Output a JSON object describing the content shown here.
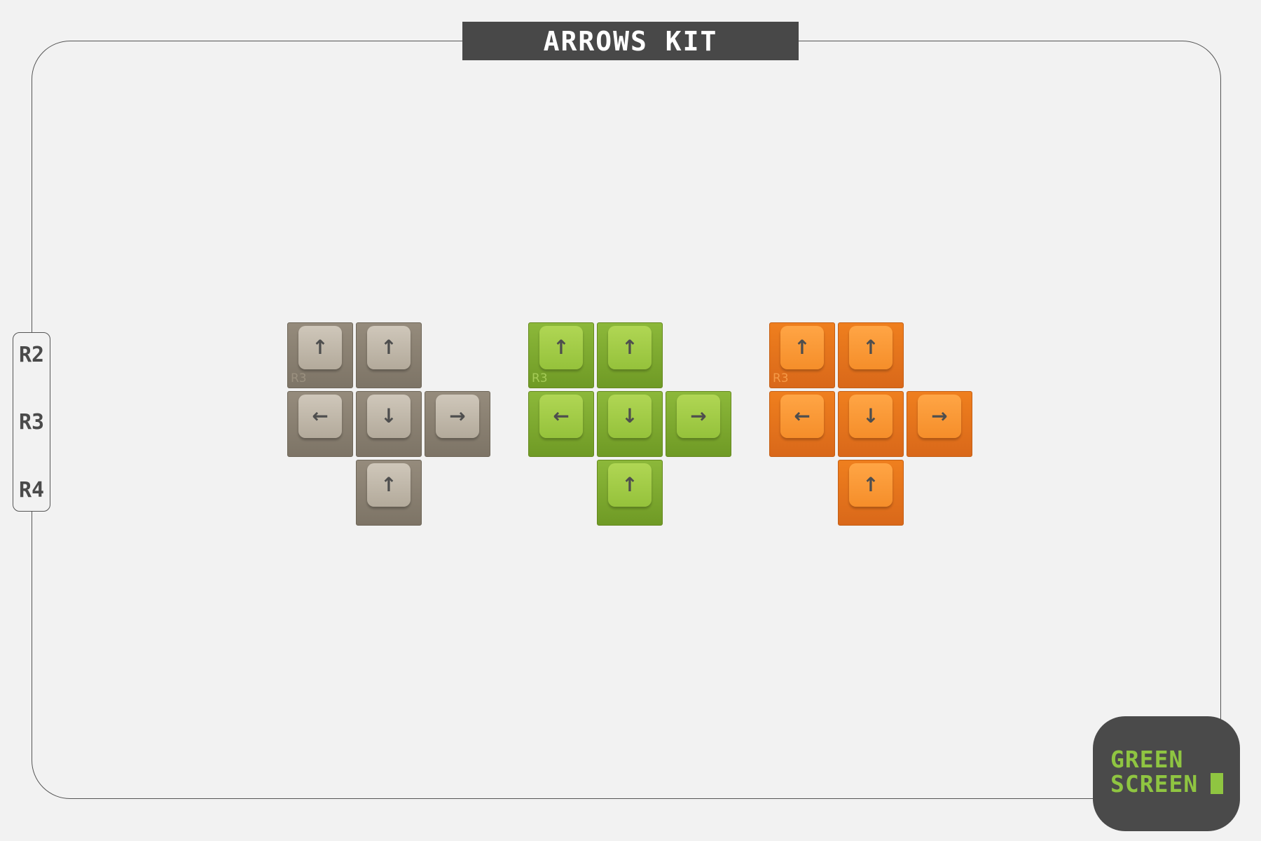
{
  "title": "ARROWS KIT",
  "row_labels": [
    "R2",
    "R3",
    "R4"
  ],
  "row_tag": "R3",
  "colors": {
    "beige": "#b3aa9b",
    "green": "#95c23b",
    "orange": "#f58e2a",
    "legend": "#4e4e4e",
    "logo_bg": "#4a4a4a",
    "logo_text": "#8fc541"
  },
  "kits": [
    {
      "colorway": "beige",
      "keys": [
        {
          "glyph": "↑",
          "icon": "up-arrow-icon",
          "tag": true
        },
        {
          "glyph": "↑",
          "icon": "up-arrow-icon",
          "tag": false
        },
        {
          "glyph": "←",
          "icon": "left-arrow-icon",
          "tag": false
        },
        {
          "glyph": "↓",
          "icon": "down-arrow-icon",
          "tag": false
        },
        {
          "glyph": "→",
          "icon": "right-arrow-icon",
          "tag": false
        },
        {
          "glyph": "↑",
          "icon": "up-arrow-icon",
          "tag": false
        }
      ]
    },
    {
      "colorway": "green",
      "keys": [
        {
          "glyph": "↑",
          "icon": "up-arrow-icon",
          "tag": true
        },
        {
          "glyph": "↑",
          "icon": "up-arrow-icon",
          "tag": false
        },
        {
          "glyph": "←",
          "icon": "left-arrow-icon",
          "tag": false
        },
        {
          "glyph": "↓",
          "icon": "down-arrow-icon",
          "tag": false
        },
        {
          "glyph": "→",
          "icon": "right-arrow-icon",
          "tag": false
        },
        {
          "glyph": "↑",
          "icon": "up-arrow-icon",
          "tag": false
        }
      ]
    },
    {
      "colorway": "orange",
      "keys": [
        {
          "glyph": "↑",
          "icon": "up-arrow-icon",
          "tag": true
        },
        {
          "glyph": "↑",
          "icon": "up-arrow-icon",
          "tag": false
        },
        {
          "glyph": "←",
          "icon": "left-arrow-icon",
          "tag": false
        },
        {
          "glyph": "↓",
          "icon": "down-arrow-icon",
          "tag": false
        },
        {
          "glyph": "→",
          "icon": "right-arrow-icon",
          "tag": false
        },
        {
          "glyph": "↑",
          "icon": "up-arrow-icon",
          "tag": false
        }
      ]
    }
  ],
  "logo": {
    "line1": "GREEN",
    "line2": "SCREEN"
  }
}
